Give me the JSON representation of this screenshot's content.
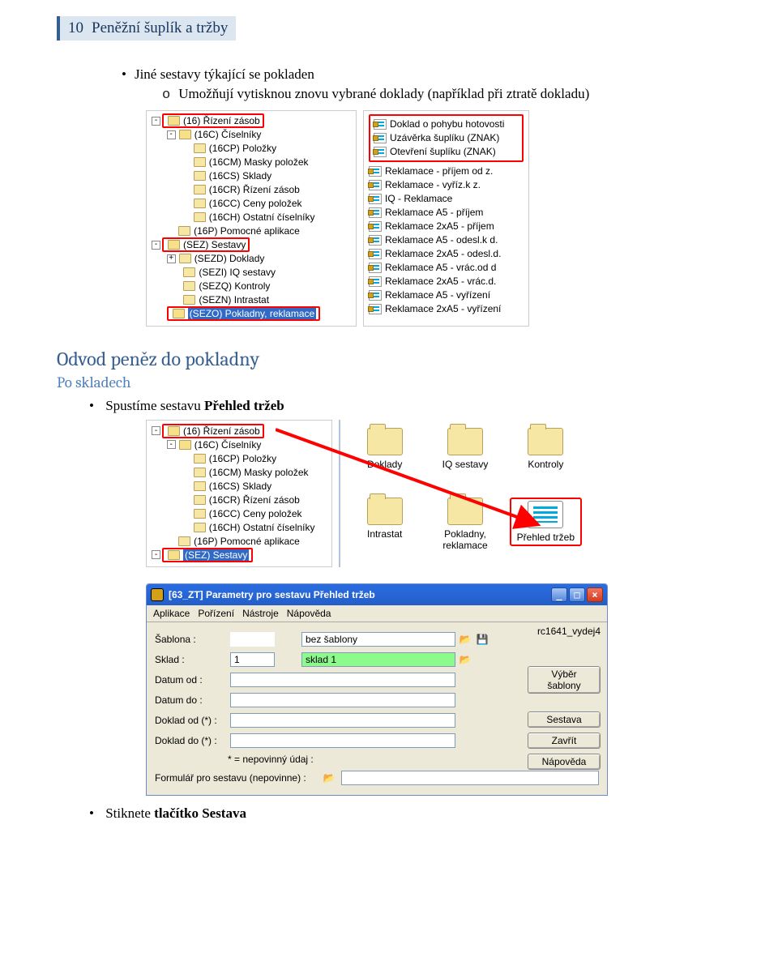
{
  "header": {
    "page_no": "10",
    "title": "Peněžní šuplík a tržby"
  },
  "text1": {
    "bullet1": "Jiné sestavy týkající se pokladen",
    "sub1_prefix": "o",
    "sub1": "Umožňují vytisknou znovu vybrané doklady (například při ztratě dokladu)"
  },
  "tree1": {
    "n0": "(16) Řízení zásob",
    "n1": "(16C) Číselníky",
    "n2": "(16CP) Položky",
    "n3": "(16CM) Masky položek",
    "n4": "(16CS) Sklady",
    "n5": "(16CR) Řízení zásob",
    "n6": "(16CC) Ceny položek",
    "n7": "(16CH) Ostatní číselníky",
    "n8": "(16P) Pomocné aplikace",
    "n9": "(SEZ) Sestavy",
    "n10": "(SEZD) Doklady",
    "n11": "(SEZI) IQ sestavy",
    "n12": "(SEZQ) Kontroly",
    "n13": "(SEZN) Intrastat",
    "n14": "(SEZO) Pokladny, reklamace"
  },
  "rlist1": {
    "i0": "Doklad o pohybu hotovosti",
    "i1": "Uzávěrka šuplíku (ZNAK)",
    "i2": "Otevření šuplíku (ZNAK)",
    "i3": "Reklamace - příjem od z.",
    "i4": "Reklamace - vyříz.k z.",
    "i5": "IQ - Reklamace",
    "i6": "Reklamace A5 - příjem",
    "i7": "Reklamace 2xA5 - příjem",
    "i8": "Reklamace A5 - odesl.k d.",
    "i9": "Reklamace 2xA5 - odesl.d.",
    "i10": "Reklamace A5 - vrác.od d",
    "i11": "Reklamace 2xA5 - vrác.d.",
    "i12": "Reklamace A5 - vyřízení",
    "i13": "Reklamace 2xA5 - vyřízení"
  },
  "h2": "Odvod peněz do pokladny",
  "h3": "Po skladech",
  "bullet2_pre": "Spustíme sestavu ",
  "bullet2_bold": "Přehled tržeb",
  "tree2": {
    "n0": "(16) Řízení zásob",
    "n1": "(16C) Číselníky",
    "n2": "(16CP) Položky",
    "n3": "(16CM) Masky položek",
    "n4": "(16CS) Sklady",
    "n5": "(16CR) Řízení zásob",
    "n6": "(16CC) Ceny položek",
    "n7": "(16CH) Ostatní číselníky",
    "n8": "(16P) Pomocné aplikace",
    "n9": "(SEZ) Sestavy"
  },
  "icons2": {
    "i0": "Doklady",
    "i1": "IQ sestavy",
    "i2": "Kontroly",
    "i3": "Intrastat",
    "i4": "Pokladny, reklamace",
    "i5": "Přehled tržeb"
  },
  "dialog": {
    "title": "[63_ZT] Parametry pro sestavu Přehled tržeb",
    "menu": {
      "m0": "Aplikace",
      "m1": "Pořízení",
      "m2": "Nástroje",
      "m3": "Nápověda"
    },
    "fields": {
      "sablona": "Šablona :",
      "sablona_v": "bez šablony",
      "sklad": "Sklad :",
      "sklad_v1": "1",
      "sklad_v2": "sklad 1",
      "datum_od": "Datum od :",
      "datum_do": "Datum do :",
      "doklad_od": "Doklad od (*) :",
      "doklad_do": "Doklad do (*) :",
      "hint": "* = nepovinný údaj :",
      "form_lbl": "Formulář pro sestavu (nepovinne) :"
    },
    "side": {
      "rc": "rc1641_vydej4",
      "b1": "Výběr šablony",
      "b2": "Sestava",
      "b3": "Zavřít",
      "b4": "Nápověda"
    }
  },
  "bullet3_pre": "Stiknete ",
  "bullet3_bold": "tlačítko Sestava"
}
